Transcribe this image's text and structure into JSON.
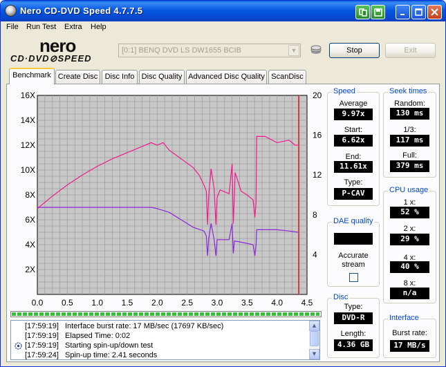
{
  "window": {
    "title": "Nero CD-DVD Speed 4.7.7.5"
  },
  "menu": [
    "File",
    "Run Test",
    "Extra",
    "Help"
  ],
  "brand": {
    "logo_top": "nero",
    "logo_bottom": "CD·DVD⊘SPEED"
  },
  "toolbar": {
    "drive": "[0:1]  BENQ DVD LS DW1655 BCIB",
    "stop_label": "Stop",
    "exit_label": "Exit"
  },
  "tabs": [
    "Benchmark",
    "Create Disc",
    "Disc Info",
    "Disc Quality",
    "Advanced Disc Quality",
    "ScanDisc"
  ],
  "active_tab": "Benchmark",
  "chart_data": {
    "type": "line",
    "xlim": [
      0,
      4.5
    ],
    "ylim_left": [
      0,
      16
    ],
    "ylim_right": [
      0,
      20
    ],
    "x_ticks": [
      "0.0",
      "0.5",
      "1.0",
      "1.5",
      "2.0",
      "2.5",
      "3.0",
      "3.5",
      "4.0",
      "4.5"
    ],
    "y_left_ticks": [
      "2X",
      "4X",
      "6X",
      "8X",
      "10X",
      "12X",
      "14X",
      "16X"
    ],
    "y_right_ticks": [
      "4",
      "8",
      "12",
      "16",
      "20"
    ],
    "grid": true,
    "series": [
      {
        "color": "#ee1a8c",
        "x": [
          0.0,
          0.25,
          0.5,
          0.75,
          1.0,
          1.25,
          1.5,
          1.75,
          1.9,
          2.0,
          2.1,
          2.2,
          2.4,
          2.6,
          2.7,
          2.78,
          2.82,
          2.84,
          2.86,
          2.9,
          2.95,
          2.98,
          3.0,
          3.05,
          3.2,
          3.25,
          3.27,
          3.29,
          3.3,
          3.4,
          3.5,
          3.6,
          3.63,
          3.65,
          3.66,
          3.8,
          4.0,
          4.2,
          4.3,
          4.35
        ],
        "y": [
          6.9,
          7.9,
          8.8,
          9.6,
          10.3,
          10.9,
          11.4,
          11.9,
          12.2,
          12.0,
          12.2,
          11.6,
          10.9,
          10.2,
          9.6,
          8.8,
          8.3,
          5.6,
          8.0,
          10.1,
          8.5,
          5.6,
          7.8,
          8.4,
          8.1,
          10.5,
          5.7,
          8.0,
          9.8,
          8.3,
          8.0,
          7.6,
          6.2,
          7.4,
          12.7,
          12.7,
          12.2,
          12.4,
          12.0,
          12.0
        ]
      },
      {
        "color": "#8b26d6",
        "x": [
          0.0,
          0.25,
          0.5,
          0.75,
          1.0,
          1.25,
          1.5,
          1.75,
          1.9,
          2.0,
          2.2,
          2.4,
          2.6,
          2.78,
          2.82,
          2.84,
          2.86,
          2.9,
          2.95,
          2.98,
          3.0,
          3.2,
          3.25,
          3.27,
          3.29,
          3.4,
          3.6,
          3.63,
          3.65,
          3.66,
          3.8,
          4.0,
          4.2,
          4.35
        ],
        "y": [
          7.0,
          7.0,
          7.0,
          7.0,
          7.0,
          7.0,
          7.0,
          7.0,
          7.0,
          6.9,
          6.6,
          6.0,
          5.4,
          5.1,
          4.7,
          3.1,
          4.5,
          5.7,
          4.4,
          3.1,
          4.4,
          4.4,
          5.7,
          3.3,
          4.3,
          4.2,
          4.0,
          3.1,
          3.9,
          5.2,
          5.2,
          5.2,
          5.1,
          5.0
        ]
      }
    ],
    "marker_x": 4.36
  },
  "progress": {
    "fraction": 0.998
  },
  "log": [
    {
      "time": "[17:59:19]",
      "msg": "Interface burst rate: 17 MB/sec (17697 KB/sec)",
      "icon": ""
    },
    {
      "time": "[17:59:19]",
      "msg": "Elapsed Time:   0:02",
      "icon": ""
    },
    {
      "time": "[17:59:19]",
      "msg": "Starting spin-up/down test",
      "icon": "gear-icon"
    },
    {
      "time": "[17:59:24]",
      "msg": "Spin-up time: 2.41 seconds",
      "icon": ""
    }
  ],
  "speed": {
    "title": "Speed",
    "average_label": "Average",
    "average": "9.97x",
    "start_label": "Start:",
    "start": "6.62x",
    "end_label": "End:",
    "end": "11.61x",
    "type_label": "Type:",
    "type": "P-CAV"
  },
  "seek": {
    "title": "Seek times",
    "random_label": "Random:",
    "random": "130 ms",
    "third_label": "1/3:",
    "third": "117 ms",
    "full_label": "Full:",
    "full": "379 ms"
  },
  "cpu": {
    "title": "CPU usage",
    "x1_label": "1 x:",
    "x1": "52 %",
    "x2_label": "2 x:",
    "x2": "29 %",
    "x4_label": "4 x:",
    "x4": "40 %",
    "x8_label": "8 x:",
    "x8": "n/a"
  },
  "dae": {
    "title": "DAE quality",
    "value": "",
    "accurate_label_1": "Accurate",
    "accurate_label_2": "stream"
  },
  "disc": {
    "title": "Disc",
    "type_label": "Type:",
    "type": "DVD-R",
    "length_label": "Length:",
    "length": "4.36 GB"
  },
  "interface": {
    "title": "Interface",
    "burst_label": "Burst rate:",
    "burst": "17 MB/s"
  }
}
